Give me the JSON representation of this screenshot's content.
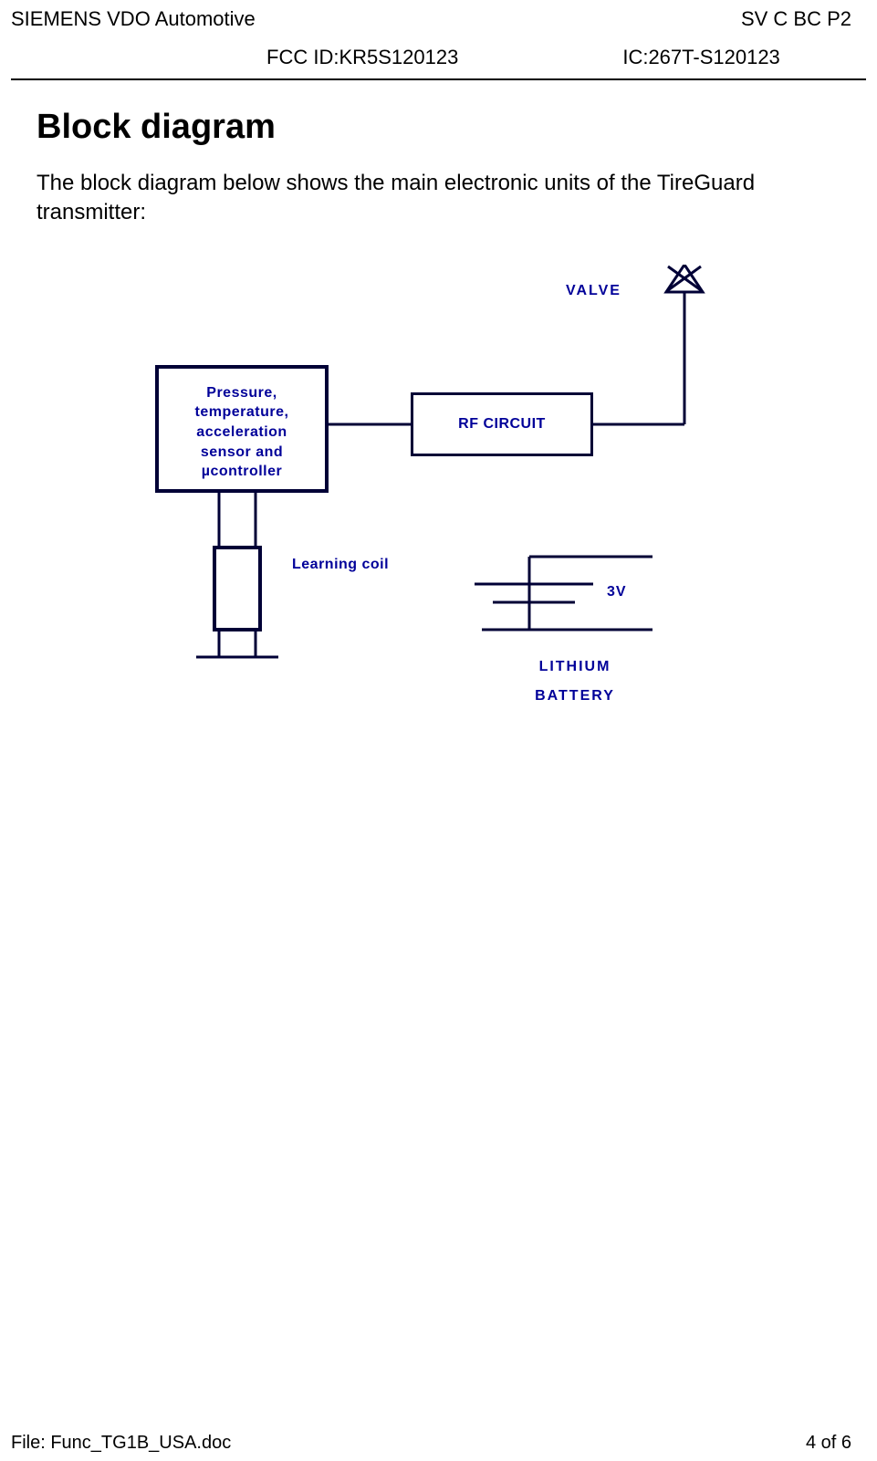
{
  "header": {
    "company": "SIEMENS VDO Automotive",
    "doccode": "SV C BC P2",
    "fcc": "FCC ID:KR5S120123",
    "ic": "IC:267T-S120123"
  },
  "title": "Block diagram",
  "intro": "The block diagram below shows the main electronic units of the TireGuard transmitter:",
  "diagram": {
    "sensor_box": "Pressure,\ntemperature,\nacceleration\nsensor and\nµcontroller",
    "rf_box": "RF CIRCUIT",
    "valve": "VALVE",
    "learning": "Learning coil",
    "voltage": "3V",
    "battery_line1": "LITHIUM",
    "battery_line2": "BATTERY"
  },
  "footer": {
    "file": "File: Func_TG1B_USA.doc",
    "page": "4 of 6"
  }
}
